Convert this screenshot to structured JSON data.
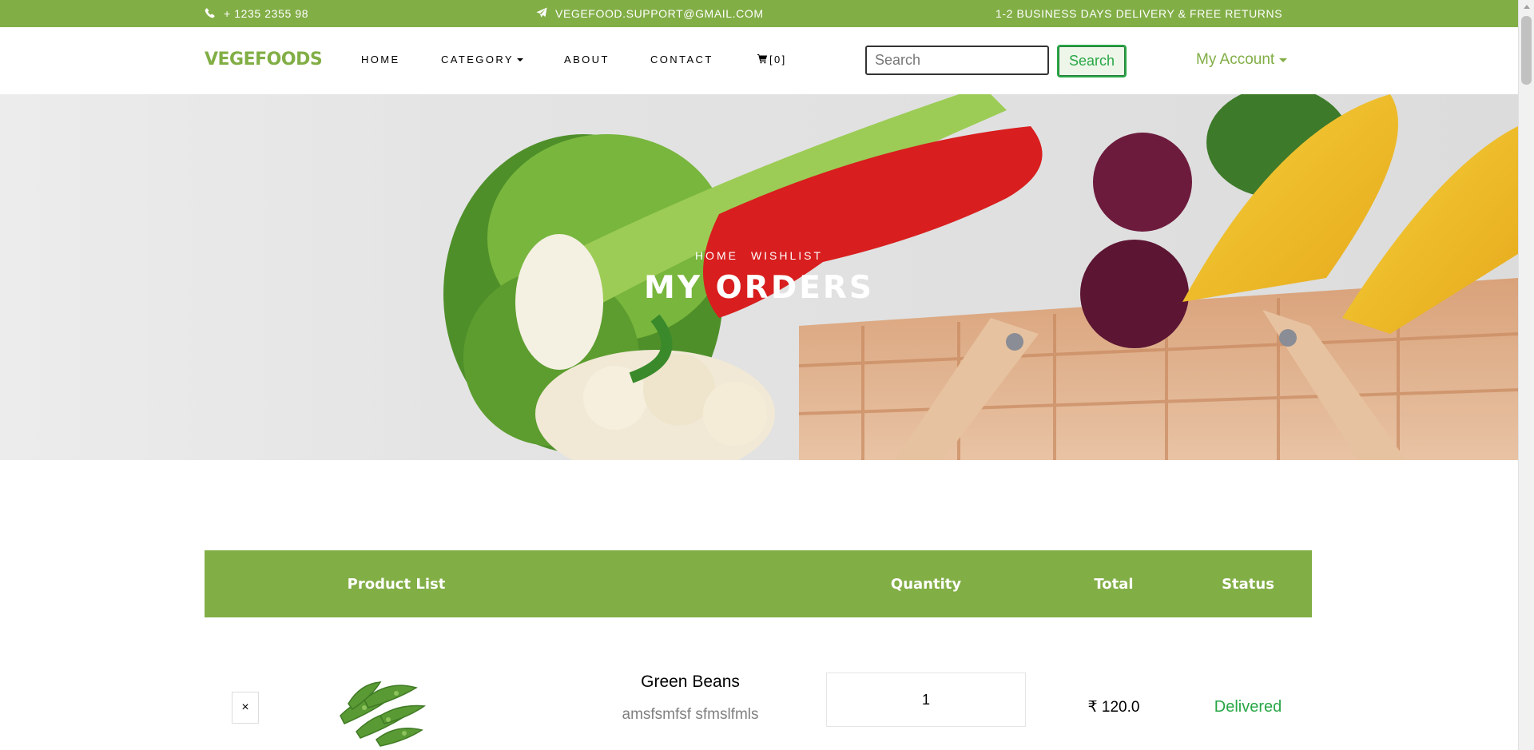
{
  "topbar": {
    "phone": "+ 1235 2355 98",
    "email": "VEGEFOOD.SUPPORT@GMAIL.COM",
    "delivery": "1-2 BUSINESS DAYS DELIVERY & FREE RETURNS",
    "icons": [
      "phone-icon",
      "paper-plane-icon"
    ]
  },
  "nav": {
    "logo": "VEGEFOODS",
    "home": "HOME",
    "category": "CATEGORY",
    "about": "ABOUT",
    "contact": "CONTACT",
    "cart": "[0]",
    "search_placeholder": "Search",
    "search_button": "Search",
    "account": "My Account"
  },
  "hero": {
    "breadcrumb_home": "HOME",
    "breadcrumb_current": "WISHLIST",
    "title": "MY ORDERS"
  },
  "table": {
    "headers": {
      "product": "Product List",
      "quantity": "Quantity",
      "total": "Total",
      "status": "Status"
    },
    "rows": [
      {
        "remove": "×",
        "name": "Green Beans",
        "description": "amsfsmfsf sfmslfmls",
        "quantity": "1",
        "total": "₹ 120.0",
        "status": "Delivered"
      }
    ]
  },
  "colors": {
    "brand_green": "#82ae46",
    "status_green": "#28a745"
  }
}
